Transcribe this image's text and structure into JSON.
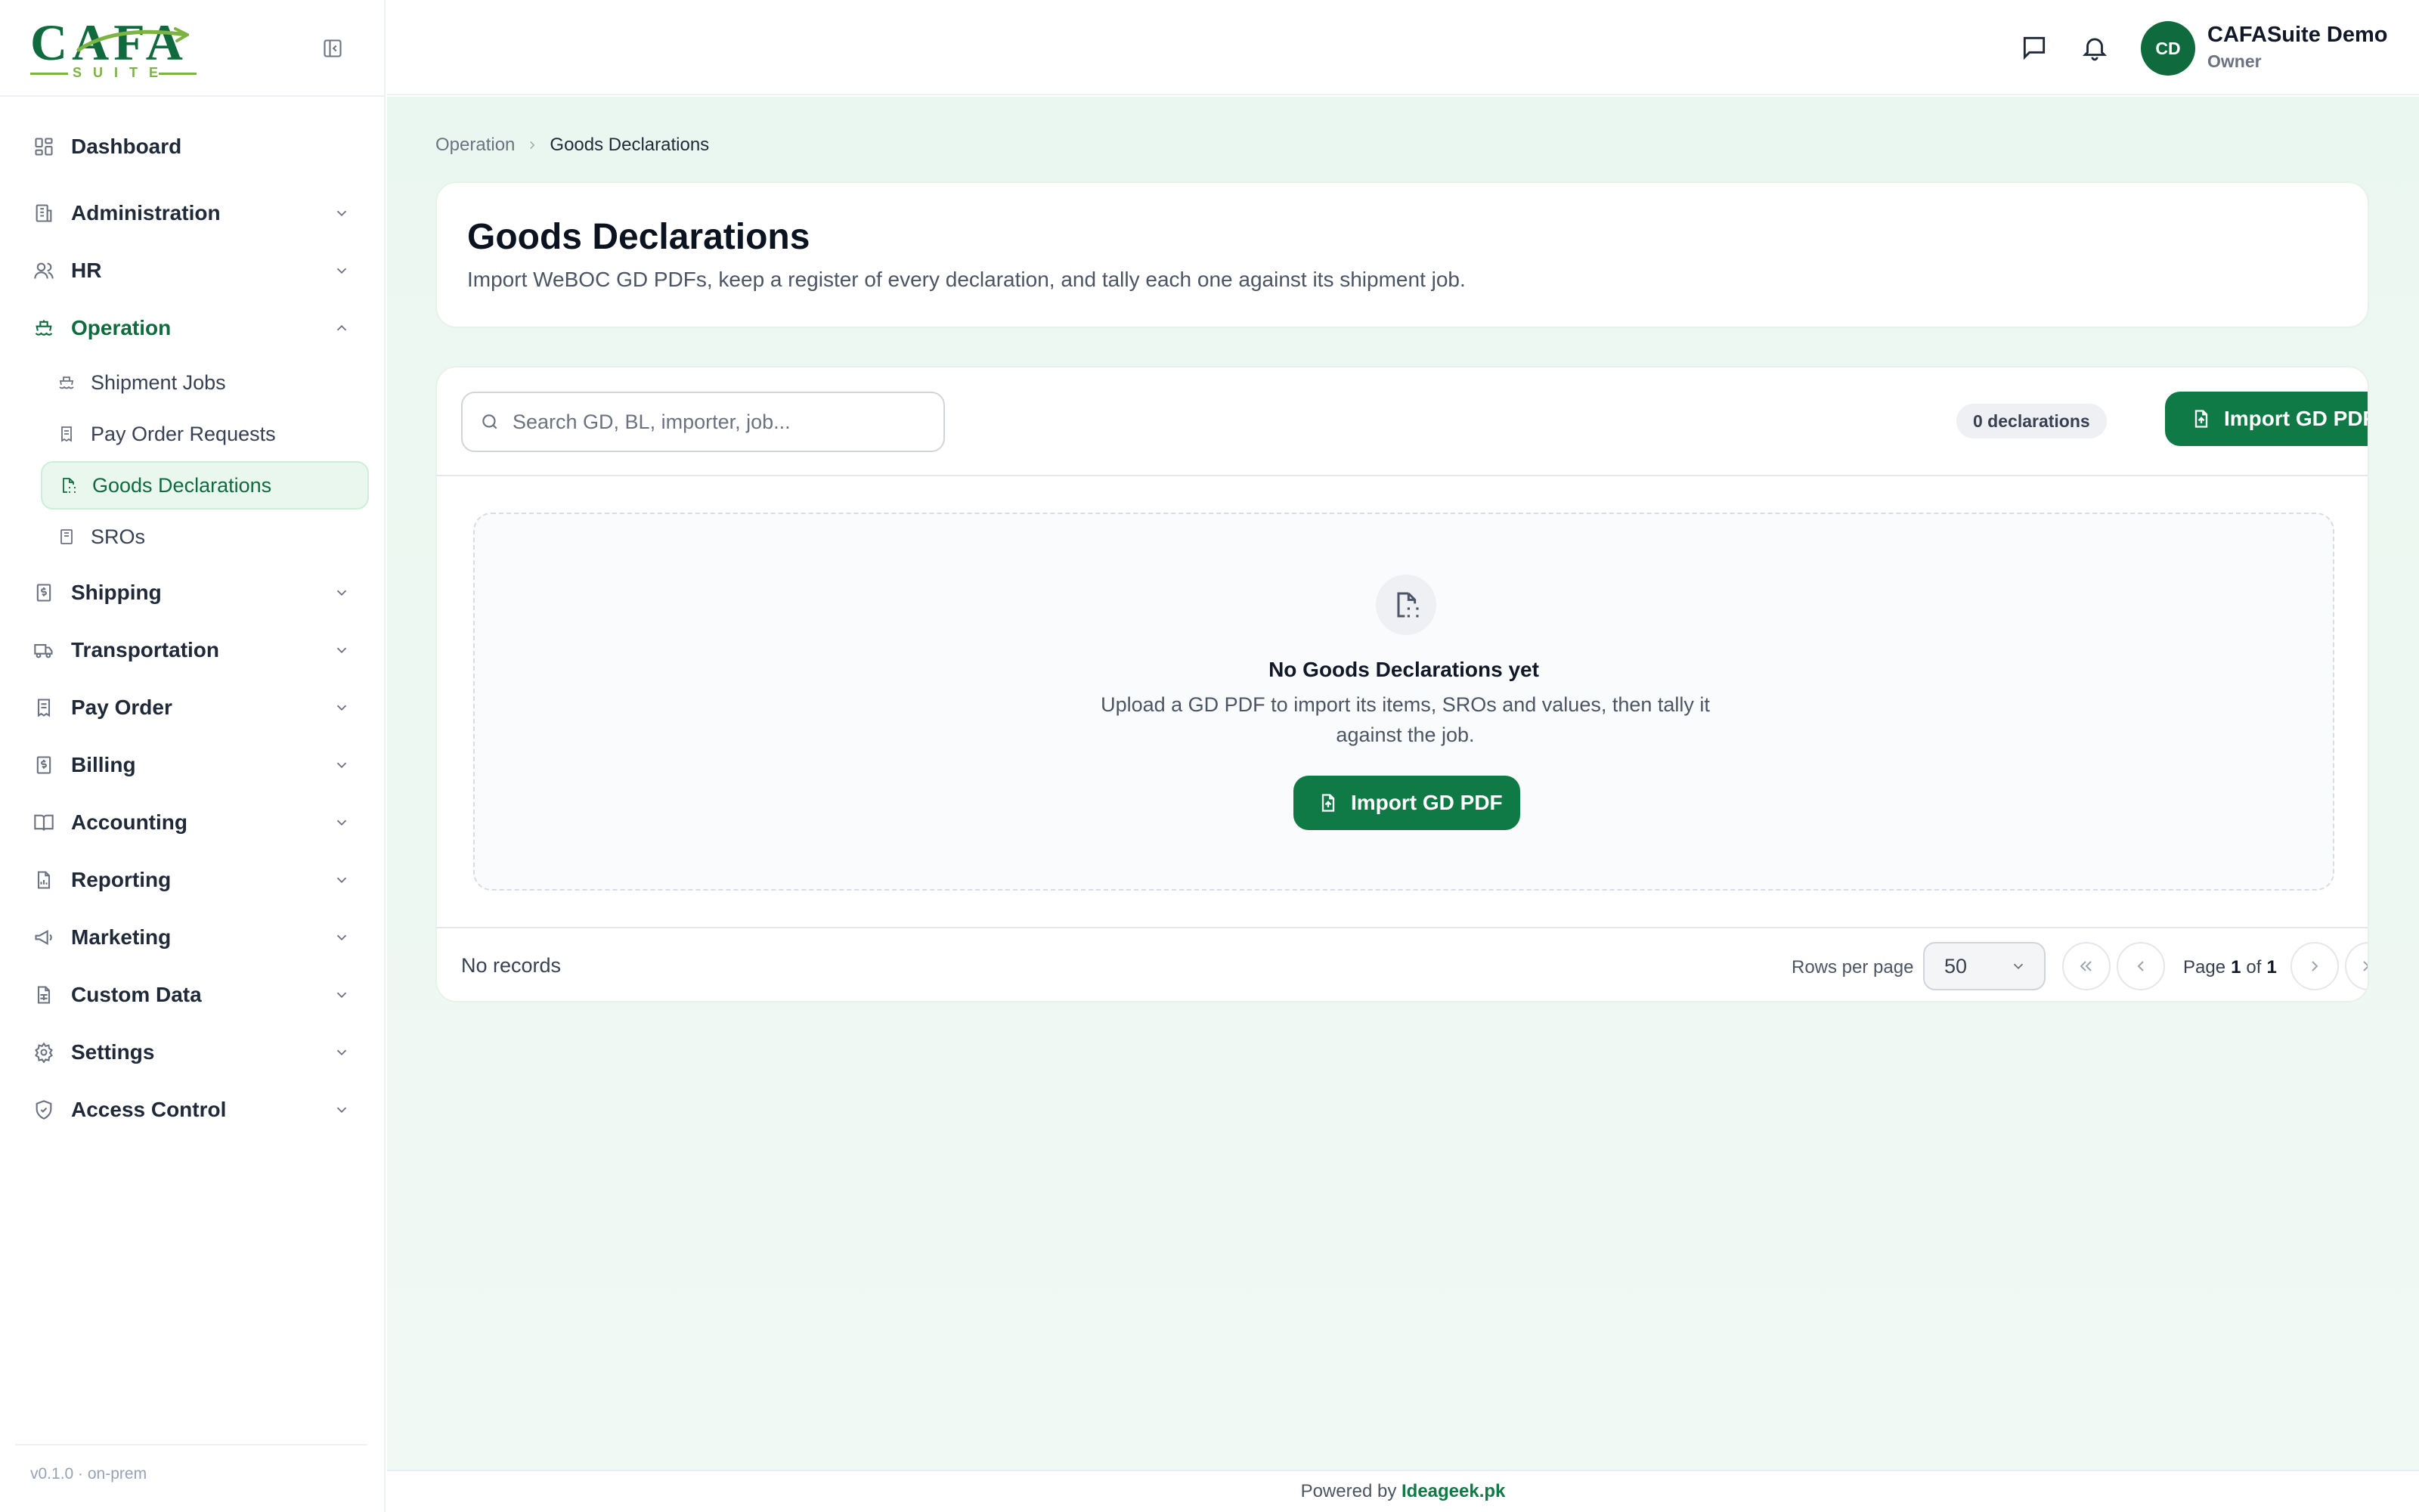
{
  "brand": {
    "logo_text": "CAFA",
    "logo_subtext": "SUITE",
    "primary_color": "#0f7a45",
    "accent_color": "#7cb342"
  },
  "sidebar": {
    "items": [
      {
        "label": "Dashboard",
        "icon": "dashboard-icon",
        "expandable": false
      },
      {
        "label": "Administration",
        "icon": "building-icon",
        "expandable": true
      },
      {
        "label": "HR",
        "icon": "users-icon",
        "expandable": true
      },
      {
        "label": "Operation",
        "icon": "ship-icon",
        "expandable": true,
        "expanded": true
      },
      {
        "label": "Shipping",
        "icon": "dollar-file-icon",
        "expandable": true
      },
      {
        "label": "Transportation",
        "icon": "truck-icon",
        "expandable": true
      },
      {
        "label": "Pay Order",
        "icon": "receipt-icon",
        "expandable": true
      },
      {
        "label": "Billing",
        "icon": "dollar-file-icon",
        "expandable": true
      },
      {
        "label": "Accounting",
        "icon": "book-icon",
        "expandable": true
      },
      {
        "label": "Reporting",
        "icon": "chart-file-icon",
        "expandable": true
      },
      {
        "label": "Marketing",
        "icon": "megaphone-icon",
        "expandable": true
      },
      {
        "label": "Custom Data",
        "icon": "spreadsheet-icon",
        "expandable": true
      },
      {
        "label": "Settings",
        "icon": "gear-icon",
        "expandable": true
      },
      {
        "label": "Access Control",
        "icon": "shield-icon",
        "expandable": true
      }
    ],
    "operation_children": [
      {
        "label": "Shipment Jobs",
        "icon": "ship-icon"
      },
      {
        "label": "Pay Order Requests",
        "icon": "receipt-icon"
      },
      {
        "label": "Goods Declarations",
        "icon": "file-scan-icon",
        "active": true
      },
      {
        "label": "SROs",
        "icon": "book-icon"
      }
    ],
    "version": "v0.1.0 · on-prem"
  },
  "topbar": {
    "user_initials": "CD",
    "user_name": "CAFASuite Demo",
    "user_role": "Owner"
  },
  "breadcrumb": {
    "parent": "Operation",
    "current": "Goods Declarations"
  },
  "header": {
    "title": "Goods Declarations",
    "description": "Import WeBOC GD PDFs, keep a register of every declaration, and tally each one against its shipment job."
  },
  "toolbar": {
    "search_placeholder": "Search GD, BL, importer, job...",
    "search_value": "",
    "count_badge": "0 declarations",
    "import_button": "Import GD PDF"
  },
  "empty_state": {
    "title": "No Goods Declarations yet",
    "description": "Upload a GD PDF to import its items, SROs and values, then tally it against the job.",
    "button": "Import GD PDF"
  },
  "pagination": {
    "records_text": "No records",
    "rows_per_page_label": "Rows per page",
    "rows_per_page_value": "50",
    "page_prefix": "Page",
    "current_page": "1",
    "page_of": "of",
    "total_pages": "1"
  },
  "footer": {
    "powered_by": "Powered by",
    "powered_link": "Ideageek.pk"
  }
}
